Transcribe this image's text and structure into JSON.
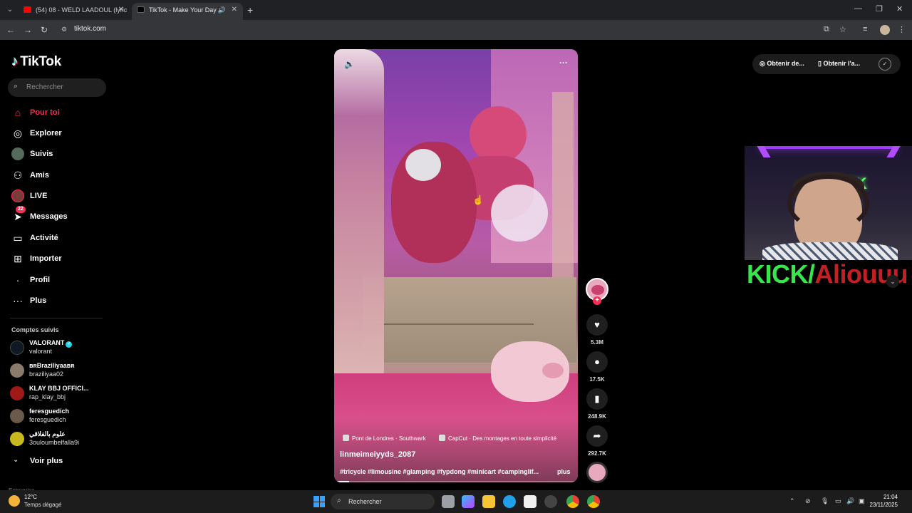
{
  "browser": {
    "tabs": [
      {
        "title": "(54) 08 - WELD LAADOUL (lyric",
        "favicon_color": "#ff0000"
      },
      {
        "title": "TikTok - Make Your Day",
        "favicon_color": "#000000"
      }
    ],
    "url": "tiktok.com"
  },
  "sidebar": {
    "logo_text": "TikTok",
    "search_placeholder": "Rechercher",
    "nav": [
      {
        "label": "Pour toi",
        "icon": "home-icon",
        "active": true
      },
      {
        "label": "Explorer",
        "icon": "compass-icon"
      },
      {
        "label": "Suivis",
        "icon": "following-avatar-icon"
      },
      {
        "label": "Amis",
        "icon": "friends-icon"
      },
      {
        "label": "LIVE",
        "icon": "live-avatar-icon"
      },
      {
        "label": "Messages",
        "icon": "paper-plane-icon",
        "badge": "22"
      },
      {
        "label": "Activité",
        "icon": "activity-icon"
      },
      {
        "label": "Importer",
        "icon": "upload-icon"
      },
      {
        "label": "Profil",
        "icon": "profile-icon"
      },
      {
        "label": "Plus",
        "icon": "more-icon"
      }
    ],
    "followed_title": "Comptes suivis",
    "followed": [
      {
        "name": "VALORANT",
        "handle": "valorant",
        "verified": true,
        "color": "#0f1923"
      },
      {
        "name": "ʙʀBraziliyaaʙʀ",
        "handle": "braziliyaa02",
        "color": "#8a7a6a"
      },
      {
        "name": "KLAY BBJ OFFICI...",
        "handle": "rap_klay_bbj",
        "color": "#a01818"
      },
      {
        "name": "feresguedich",
        "handle": "feresguedich",
        "color": "#6a5a4a"
      },
      {
        "name": "علوم بالفلاقي",
        "handle": "3ouloumbelfalla9i",
        "color": "#c8b820"
      }
    ],
    "see_more": "Voir plus",
    "truncated_section": "Entreprise"
  },
  "video": {
    "tags": [
      {
        "text": "Pont de Londres · Southwark",
        "icon": "location-icon"
      },
      {
        "text": "CapCut · Des montages en toute simplicité",
        "icon": "capcut-icon"
      }
    ],
    "author": "linmeimeiyyds_2087",
    "description": "#tricycle #limousine #glamping #fypdong #minicart #campinglif...",
    "more_label": "plus",
    "progress": 0.06
  },
  "actions": {
    "likes": "5.3M",
    "comments": "17.5K",
    "saves": "248.9K",
    "shares": "292.7K"
  },
  "topright": {
    "coins_label": "Obtenir de...",
    "app_label": "Obtenir l'a..."
  },
  "stream_overlay": {
    "kick_prefix": "KICK/",
    "kick_name": "Aliouuu"
  },
  "taskbar": {
    "temperature": "12°C",
    "weather": "Temps dégagé",
    "search": "Rechercher",
    "time": "21:04",
    "date": "23/11/2025"
  }
}
